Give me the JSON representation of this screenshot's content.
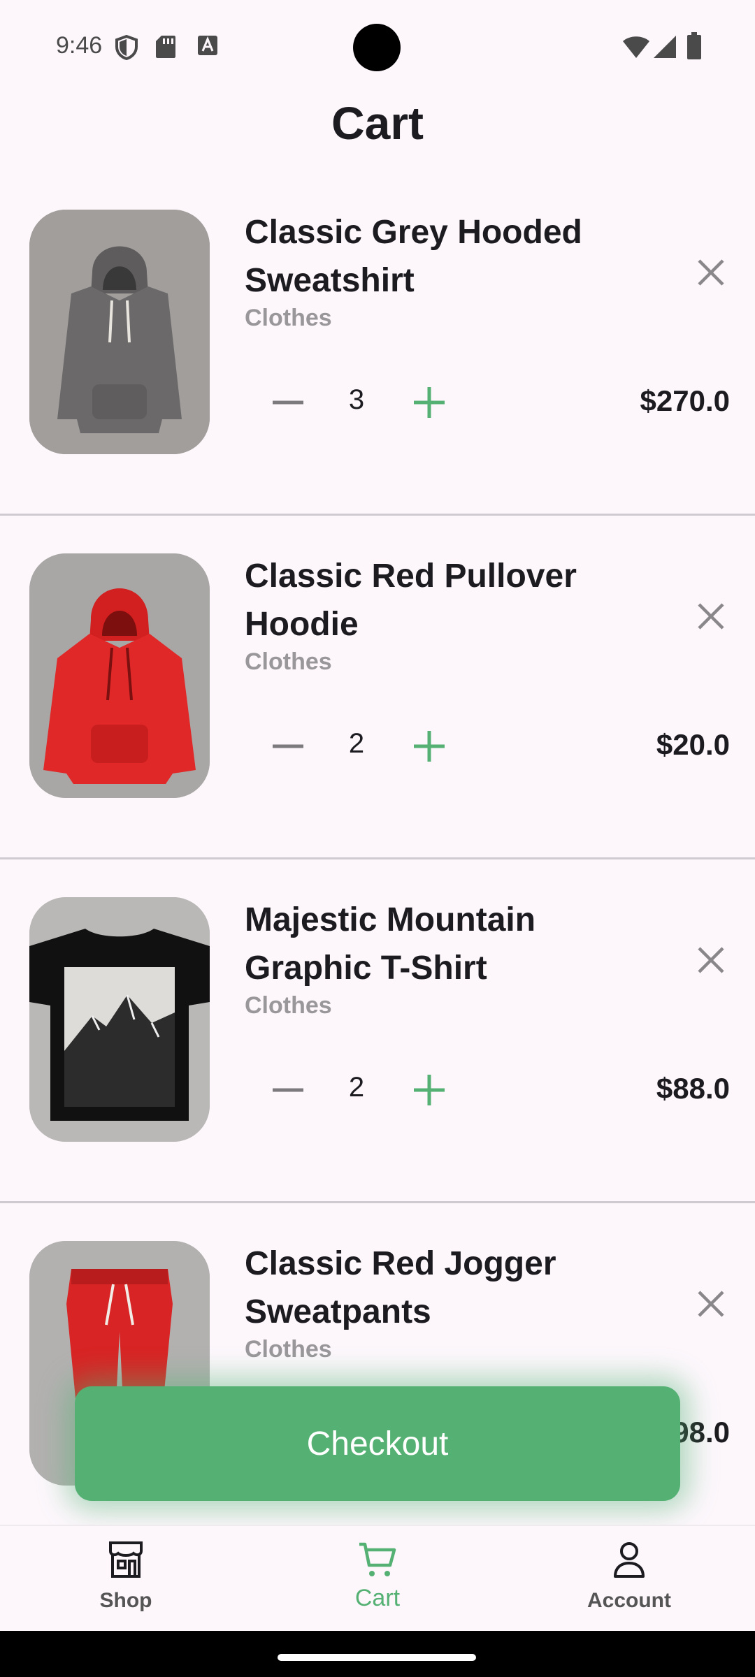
{
  "status_bar": {
    "time": "9:46",
    "icons": [
      "shield-icon",
      "sd-card-icon",
      "font-icon",
      "wifi-icon",
      "signal-icon",
      "battery-icon"
    ]
  },
  "header": {
    "title": "Cart"
  },
  "cart": {
    "items": [
      {
        "name": "Classic Grey Hooded Sweatshirt",
        "category": "Clothes",
        "quantity": "3",
        "price": "$270.0",
        "image": "grey-hoodie"
      },
      {
        "name": "Classic Red Pullover Hoodie",
        "category": "Clothes",
        "quantity": "2",
        "price": "$20.0",
        "image": "red-hoodie"
      },
      {
        "name": "Majestic Mountain Graphic T-Shirt",
        "category": "Clothes",
        "quantity": "2",
        "price": "$88.0",
        "image": "mountain-tshirt"
      },
      {
        "name": "Classic Red Jogger Sweatpants",
        "category": "Clothes",
        "quantity": "",
        "price": "$98.0",
        "image": "red-joggers"
      }
    ]
  },
  "checkout": {
    "label": "Checkout"
  },
  "nav": {
    "items": [
      {
        "label": "Shop",
        "icon": "store-icon"
      },
      {
        "label": "Cart",
        "icon": "cart-icon",
        "active": true
      },
      {
        "label": "Account",
        "icon": "person-icon"
      }
    ]
  },
  "colors": {
    "accent": "#55b173",
    "background": "#fdf7fc",
    "text": "#1c1b1f",
    "muted": "#9a979b"
  }
}
